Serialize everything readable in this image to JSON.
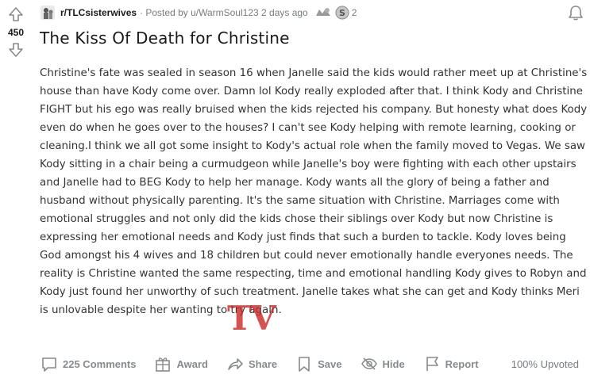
{
  "post": {
    "score": "450",
    "subreddit": "r/TLCsisterwives",
    "posted_by": "· Posted by u/WarmSoul123 2 days ago",
    "award_count": "2",
    "title": "The Kiss Of Death for Christine",
    "body": "Christine's fate was sealed in season 16 when Janelle said the kids would rather meet up at Christine's house than have Kody come over. Damn lol Kody really exploded after that. I think Kody and Christine FIGHT but his ego was really bruised when the kids rejected his company. But honesty what does Kody even do when he goes over to the houses? I can't see Kody helping with remote learning, cooking or cleaning.I think we all got some insight to Kody's actual role when the family moved to Vegas. We saw Kody sitting in a chair being a curmudgeon while Janelle's boy were fighting with each other upstairs and Janelle had to BEG Kody to help her manage. Kody wants all the glory of being a father and husband without physically parenting. It's the same situation with Christine. Marriages come with emotional struggles and not only did the kids chose their siblings over Kody but now Christine is expressing her emotional needs and Kody just finds that such a burden to tackle. Kody loves being God amongst his 4 wives and 18 children but could never emotionally handle everyones needs. The reality is Christine wanted the same respecting, time and emotional handling Kody gives to Robyn and Kody just found her unworthy of such treatment. Janelle takes what she can get and Kody thinks Meri is unlovable despite her wanting to try again.",
    "watermark": "TV"
  },
  "actions": {
    "comments": "225 Comments",
    "award": "Award",
    "share": "Share",
    "save": "Save",
    "hide": "Hide",
    "report": "Report",
    "upvoted": "100% Upvoted"
  },
  "icons": [
    "upvote-icon",
    "downvote-icon",
    "subreddit-icon",
    "award-icon",
    "silver-award-icon",
    "bell-icon",
    "comment-icon",
    "gift-icon",
    "share-icon",
    "bookmark-icon",
    "hide-icon",
    "flag-icon"
  ],
  "colors": {
    "text": "#1a1a1b",
    "muted": "#878a8c",
    "watermark": "#c82828"
  }
}
